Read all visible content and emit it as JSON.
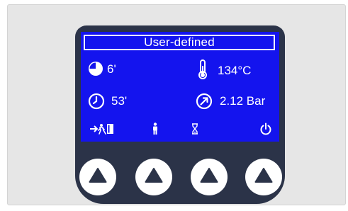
{
  "screen": {
    "title": "User-defined",
    "cycle_time": {
      "icon": "pie-chart-icon",
      "value": "6'"
    },
    "temperature": {
      "icon": "thermometer-icon",
      "value": "134°C"
    },
    "timer": {
      "icon": "clock-icon",
      "value": "53'"
    },
    "pressure": {
      "icon": "gauge-icon",
      "value": "2.12 Bar"
    },
    "function_bar": [
      "exit-door-icon",
      "person-icon",
      "hourglass-icon",
      "power-icon"
    ]
  },
  "buttons": [
    "up-arrow-button-1",
    "up-arrow-button-2",
    "up-arrow-button-3",
    "up-arrow-button-4"
  ],
  "colors": {
    "screen_bg": "#1414ee",
    "device_body": "#2b3348",
    "panel_bg": "#e6e6e6",
    "text": "#ffffff"
  }
}
